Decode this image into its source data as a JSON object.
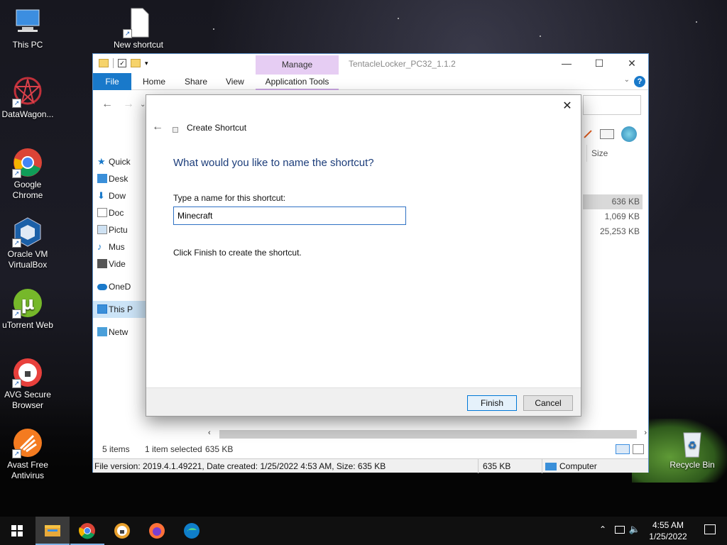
{
  "desktop": {
    "icons": [
      {
        "label": "This PC",
        "icon": "computer-icon"
      },
      {
        "label": "New shortcut",
        "icon": "shortcut-file-icon"
      },
      {
        "label": "DataWagon...",
        "icon": "datawagon-icon"
      },
      {
        "label": "Google Chrome",
        "icon": "chrome-icon"
      },
      {
        "label": "Oracle VM VirtualBox",
        "icon": "virtualbox-icon"
      },
      {
        "label": "uTorrent Web",
        "icon": "utorrent-icon"
      },
      {
        "label": "AVG Secure Browser",
        "icon": "avg-browser-icon"
      },
      {
        "label": "Avast Free Antivirus",
        "icon": "avast-icon"
      },
      {
        "label": "Recycle Bin",
        "icon": "recycle-bin-icon"
      }
    ]
  },
  "explorer": {
    "title": "TentacleLocker_PC32_1.1.2",
    "manage_tab": "Manage",
    "ribbon_tabs": [
      "File",
      "Home",
      "Share",
      "View",
      "Application Tools"
    ],
    "sidebar": [
      "Quick",
      "Desk",
      "Dow",
      "Doc",
      "Pictu",
      "Mus",
      "Vide",
      "OneD",
      "This P",
      "Netw"
    ],
    "column_header": "Size",
    "sizes": [
      "636 KB",
      "1,069 KB",
      "25,253 KB"
    ],
    "status": {
      "items": "5 items",
      "selected": "1 item selected",
      "selected_size": "635 KB"
    },
    "details": {
      "file_info": "File version: 2019.4.1.49221, Date created: 1/25/2022 4:53 AM, Size: 635 KB",
      "size": "635 KB",
      "location": "Computer"
    }
  },
  "dialog": {
    "title": "Create Shortcut",
    "heading": "What would you like to name the shortcut?",
    "name_label": "Type a name for this shortcut:",
    "name_value": "Minecraft",
    "instruction": "Click Finish to create the shortcut.",
    "finish_label": "Finish",
    "cancel_label": "Cancel"
  },
  "taskbar": {
    "apps": [
      "start-icon",
      "file-explorer-icon",
      "chrome-icon",
      "avg-browser-icon",
      "firefox-icon",
      "edge-icon"
    ],
    "time": "4:55 AM",
    "date": "1/25/2022"
  },
  "colors": {
    "accent": "#1979ca",
    "manage_tab": "#e6cdf3",
    "heading": "#1c3d7a"
  }
}
